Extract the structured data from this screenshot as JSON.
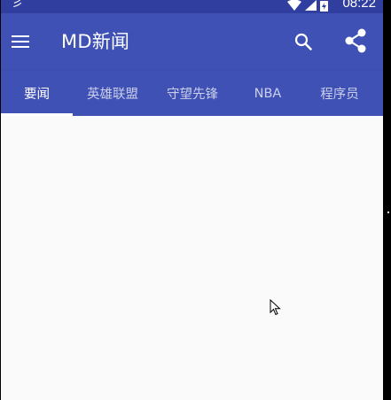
{
  "status_bar": {
    "left_glyph": "彡",
    "time": "08:22"
  },
  "toolbar": {
    "title": "MD新闻",
    "menu_icon": "menu-icon",
    "search_icon": "search-icon",
    "share_icon": "share-icon"
  },
  "tabs": [
    {
      "label": "要闻",
      "active": true
    },
    {
      "label": "英雄联盟",
      "active": false
    },
    {
      "label": "守望先锋",
      "active": false
    },
    {
      "label": "NBA",
      "active": false
    },
    {
      "label": "程序员",
      "active": false
    }
  ],
  "colors": {
    "primary": "#3f51b5",
    "primary_dark": "#303f9f",
    "background": "#fafafa"
  }
}
